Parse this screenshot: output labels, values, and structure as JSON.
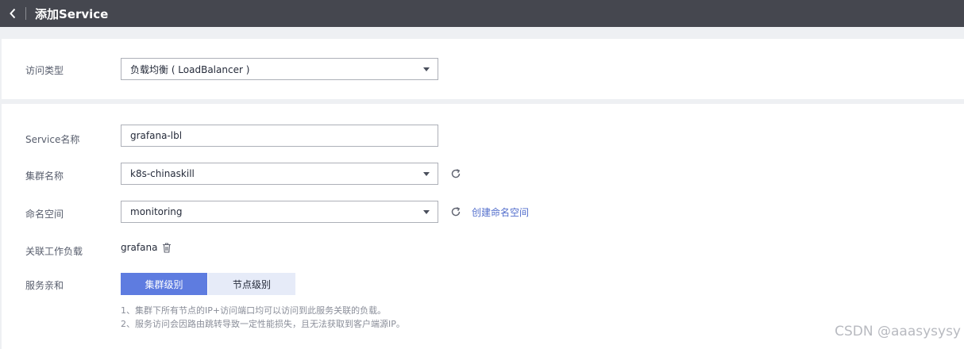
{
  "header": {
    "title": "添加Service"
  },
  "access_type": {
    "label": "访问类型",
    "value": "负载均衡 ( LoadBalancer )"
  },
  "form": {
    "service_name": {
      "label": "Service名称",
      "value": "grafana-lbl"
    },
    "cluster_name": {
      "label": "集群名称",
      "value": "k8s-chinaskill"
    },
    "namespace": {
      "label": "命名空间",
      "value": "monitoring",
      "create_link": "创建命名空间"
    },
    "workload": {
      "label": "关联工作负载",
      "value": "grafana"
    },
    "affinity": {
      "label": "服务亲和",
      "options": [
        "集群级别",
        "节点级别"
      ],
      "selected": "集群级别",
      "hints": [
        "1、集群下所有节点的IP+访问端口均可以访问到此服务关联的负载。",
        "2、服务访问会因路由跳转导致一定性能损失，且无法获取到客户端源IP。"
      ]
    }
  },
  "watermark": "CSDN @aaasysysy",
  "colors": {
    "topbar": "#45474f",
    "accent": "#5e7ce0",
    "link": "#526ecc"
  }
}
